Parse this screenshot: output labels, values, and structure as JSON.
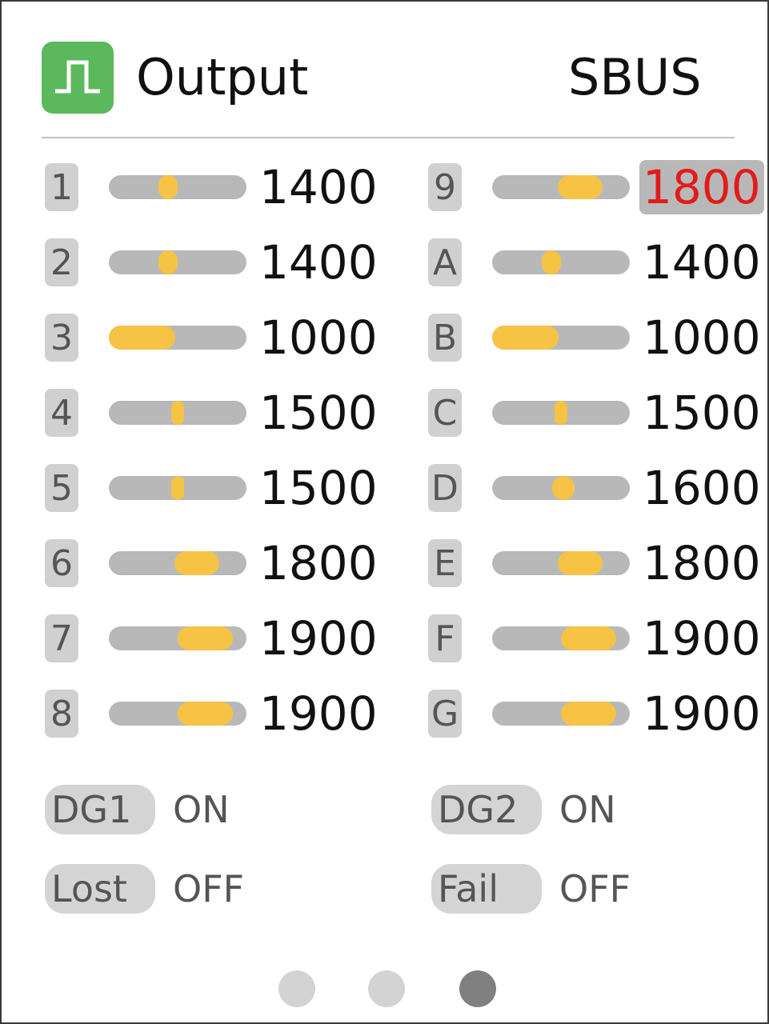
{
  "header": {
    "title": "Output",
    "protocol": "SBUS",
    "icon": "pulse-signal-icon",
    "icon_color": "#5cb85c"
  },
  "channels_left": [
    {
      "label": "1",
      "value": "1400"
    },
    {
      "label": "2",
      "value": "1400"
    },
    {
      "label": "3",
      "value": "1000"
    },
    {
      "label": "4",
      "value": "1500"
    },
    {
      "label": "5",
      "value": "1500"
    },
    {
      "label": "6",
      "value": "1800"
    },
    {
      "label": "7",
      "value": "1900"
    },
    {
      "label": "8",
      "value": "1900"
    }
  ],
  "channels_right": [
    {
      "label": "9",
      "value": "1800",
      "selected": true
    },
    {
      "label": "A",
      "value": "1400"
    },
    {
      "label": "B",
      "value": "1000"
    },
    {
      "label": "C",
      "value": "1500"
    },
    {
      "label": "D",
      "value": "1600"
    },
    {
      "label": "E",
      "value": "1800"
    },
    {
      "label": "F",
      "value": "1900"
    },
    {
      "label": "G",
      "value": "1900"
    }
  ],
  "flags": {
    "dg1": {
      "label": "DG1",
      "value": "ON"
    },
    "dg2": {
      "label": "DG2",
      "value": "ON"
    },
    "lost": {
      "label": "Lost",
      "value": "OFF"
    },
    "fail": {
      "label": "Fail",
      "value": "OFF"
    }
  },
  "pager": {
    "count": 3,
    "active": 3
  },
  "colors": {
    "accent": "#5cb85c",
    "slider_fill": "#f6c344",
    "slider_track": "#b8b8b8",
    "selected_value": "#e21b1b"
  }
}
